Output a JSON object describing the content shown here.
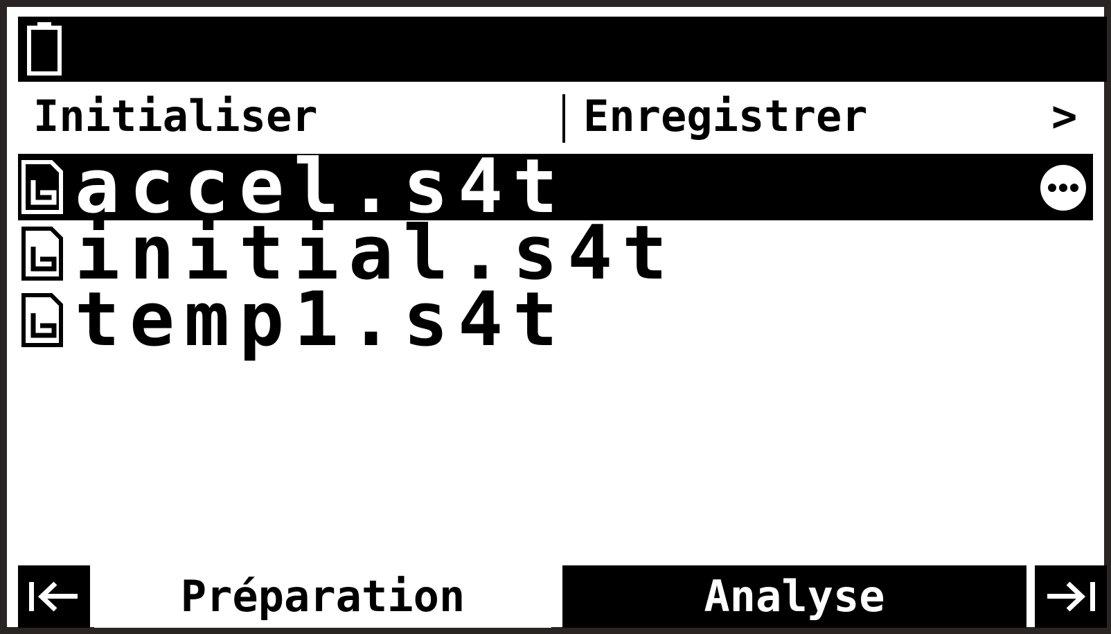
{
  "status_bar": {
    "battery_icon": "battery-icon"
  },
  "menu": {
    "initialize": "Initialiser",
    "save": "Enregistrer",
    "more": ">"
  },
  "files": [
    {
      "name": "accel.s4t",
      "selected": true,
      "icon": "file-icon"
    },
    {
      "name": "initial.s4t",
      "selected": false,
      "icon": "file-icon"
    },
    {
      "name": "temp1.s4t",
      "selected": false,
      "icon": "file-icon"
    }
  ],
  "selected_more_icon": "ellipsis-circle-icon",
  "tabs": {
    "preparation": "Préparation",
    "analyse": "Analyse",
    "active": "preparation"
  },
  "nav": {
    "first_icon": "first-page-icon",
    "last_icon": "last-page-icon"
  },
  "colors": {
    "background": "#ffffff",
    "foreground": "#000000",
    "frame": "#2a2522"
  }
}
